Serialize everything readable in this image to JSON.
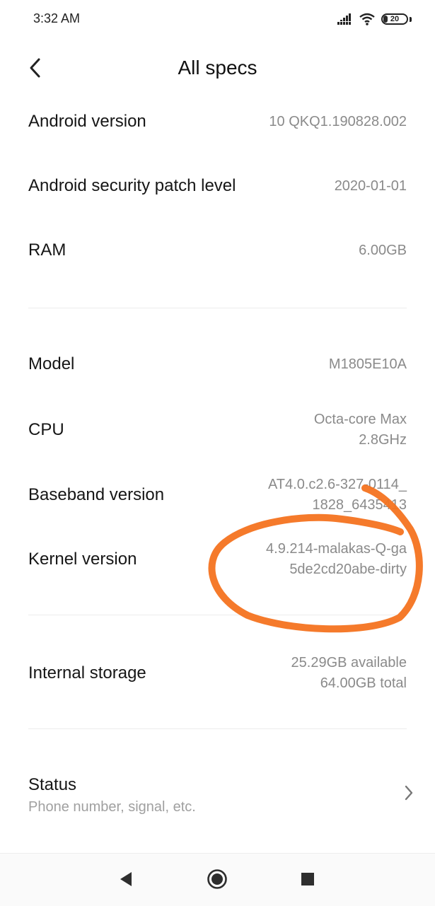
{
  "status_bar": {
    "time": "3:32 AM",
    "battery": "20",
    "battery_level": 0.2,
    "icons": [
      "signal-icon",
      "wifi-icon",
      "battery-icon"
    ]
  },
  "header": {
    "title": "All specs",
    "back_icon": "chevron-left-icon"
  },
  "specs": {
    "android_version": {
      "label": "Android version",
      "value": "10 QKQ1.190828.002"
    },
    "security_patch": {
      "label": "Android security patch level",
      "value": "2020-01-01"
    },
    "ram": {
      "label": "RAM",
      "value": "6.00GB"
    },
    "model": {
      "label": "Model",
      "value": "M1805E10A"
    },
    "cpu": {
      "label": "CPU",
      "value": "Octa-core Max\n2.8GHz"
    },
    "baseband": {
      "label": "Baseband version",
      "value": "AT4.0.c2.6-327-0114_\n1828_6435413"
    },
    "kernel": {
      "label": "Kernel version",
      "value": "4.9.214-malakas-Q-ga\n5de2cd20abe-dirty"
    },
    "storage": {
      "label": "Internal storage",
      "value": "25.29GB available\n64.00GB total"
    }
  },
  "status_item": {
    "title": "Status",
    "subtitle": "Phone number, signal, etc.",
    "icon": "chevron-right-icon"
  },
  "nav_bar": {
    "icons": [
      "back-triangle-icon",
      "home-circle-icon",
      "recents-square-icon"
    ]
  },
  "colors": {
    "annotation": "#f47320",
    "label": "#161616",
    "value": "#8a8a8a"
  }
}
